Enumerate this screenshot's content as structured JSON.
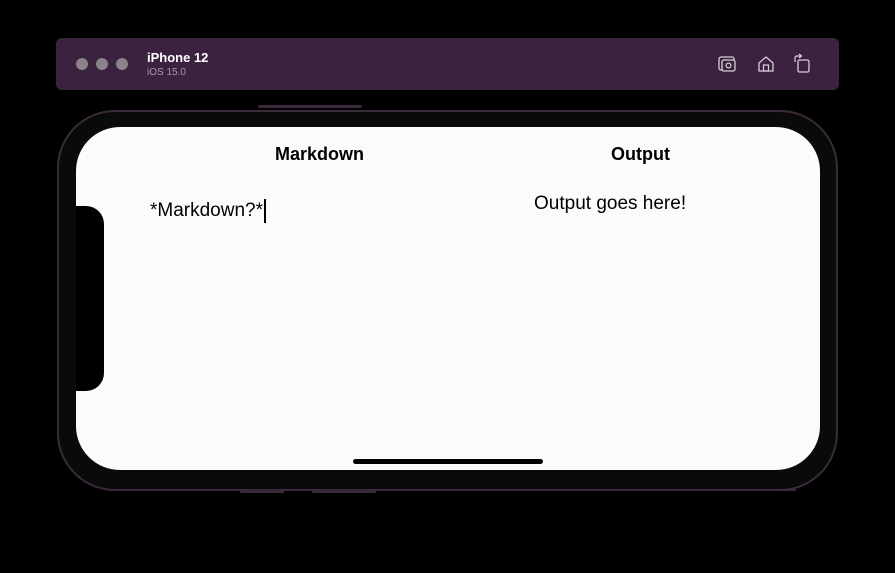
{
  "simulator": {
    "device_name": "iPhone 12",
    "os_version": "iOS 15.0",
    "toolbar_icons": [
      "screenshot-icon",
      "home-icon",
      "rotate-icon"
    ]
  },
  "app": {
    "markdown_header": "Markdown",
    "output_header": "Output",
    "editor_value": "*Markdown?*",
    "output_text": "Output goes here!"
  },
  "colors": {
    "titlebar": "#3b2340",
    "screen_background": "#fbfbfd",
    "device_frame": "#3b2a3c"
  }
}
